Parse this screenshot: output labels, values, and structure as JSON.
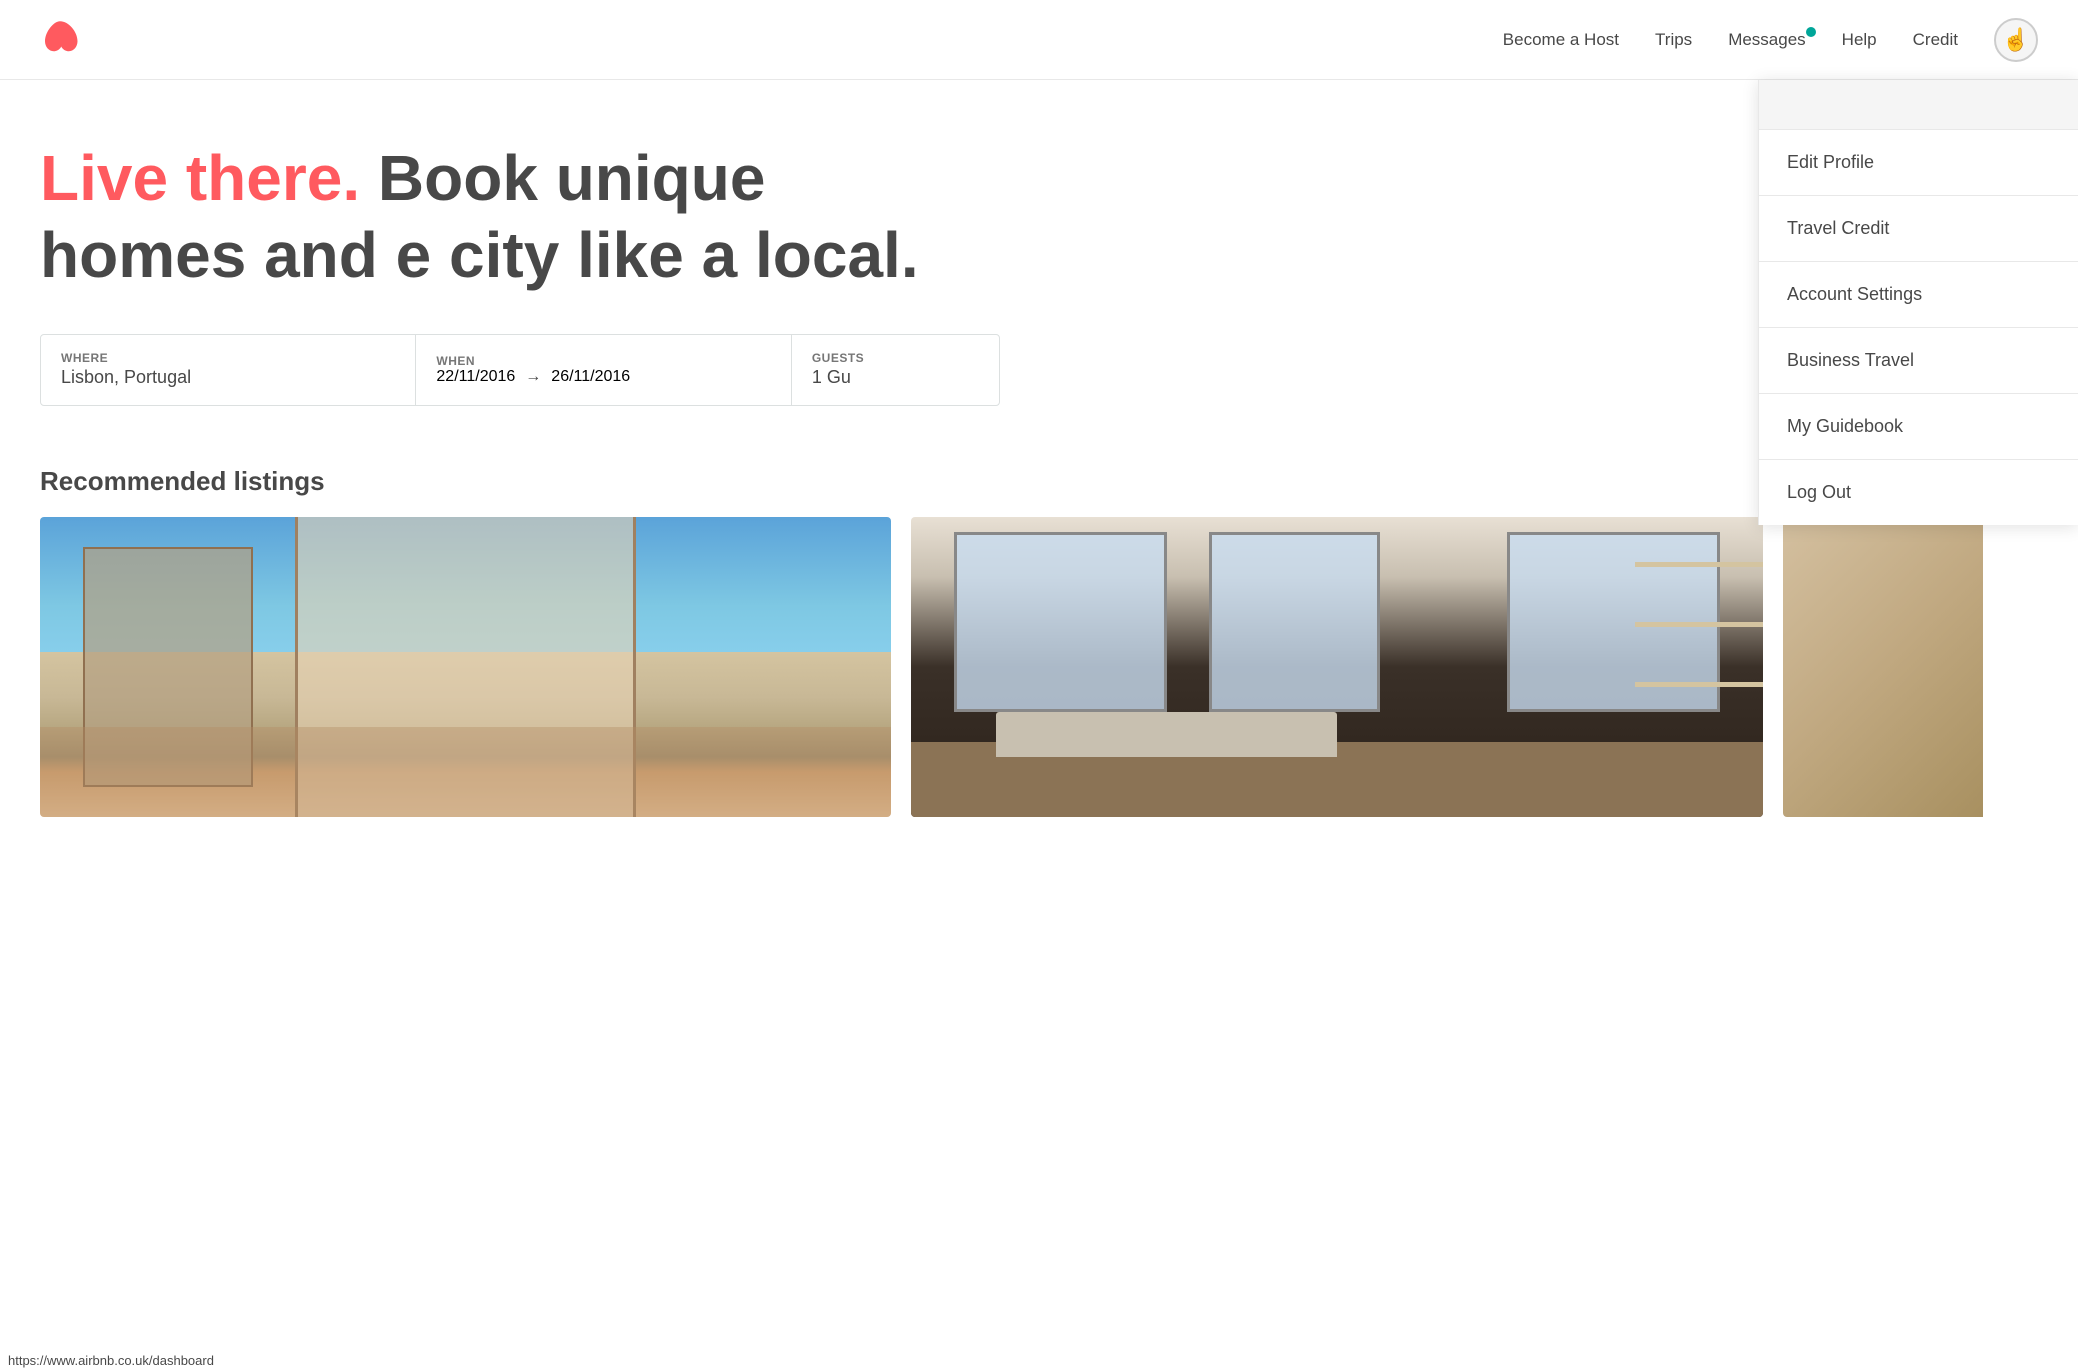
{
  "header": {
    "logo_alt": "Airbnb",
    "nav": {
      "become_host": "Become a Host",
      "trips": "Trips",
      "messages": "Messages",
      "help": "Help",
      "credit": "Credit"
    },
    "messages_dot_color": "#00a699"
  },
  "hero": {
    "live_there": "Live there.",
    "rest": " Book unique homes and e city like a local."
  },
  "search": {
    "where_label": "Where",
    "where_value": "Lisbon, Portugal",
    "when_label": "When",
    "date_from": "22/11/2016",
    "date_to": "26/11/2016",
    "guests_label": "Guests",
    "guests_value": "1 Gu"
  },
  "recommended": {
    "title": "Recommended listings"
  },
  "dropdown": {
    "items": [
      {
        "id": "edit-profile",
        "label": "Edit Profile"
      },
      {
        "id": "travel-credit",
        "label": "Travel Credit"
      },
      {
        "id": "account-settings",
        "label": "Account Settings"
      },
      {
        "id": "business-travel",
        "label": "Business Travel"
      },
      {
        "id": "my-guidebook",
        "label": "My Guidebook"
      },
      {
        "id": "log-out",
        "label": "Log Out"
      }
    ]
  },
  "status_bar": {
    "url": "https://www.airbnb.co.uk/dashboard"
  },
  "colors": {
    "airbnb_red": "#ff5a5f",
    "text_dark": "#484848",
    "text_light": "#767676",
    "border": "#e8e8e8",
    "teal": "#00a699"
  },
  "listing_images": [
    {
      "bg": "linear-gradient(135deg, #87CEEB 0%, #87CEEB 40%, #f5f0e8 40%, #f5f0e8 100%)",
      "description": "Lisbon apartment with sea view"
    },
    {
      "bg": "linear-gradient(to bottom, #d4c9b8 0%, #8b7355 50%, #5a4a3a 100%)",
      "description": "Bright apartment with windows"
    }
  ]
}
